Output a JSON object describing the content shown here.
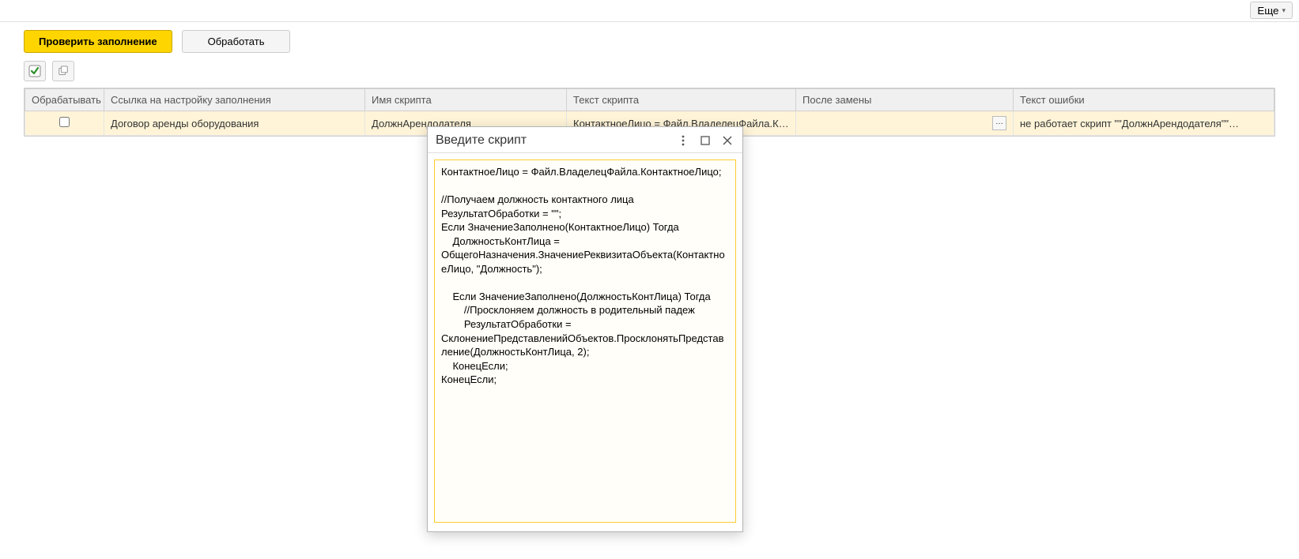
{
  "header": {
    "more": "Еще"
  },
  "toolbar": {
    "check_fill": "Проверить заполнение",
    "process": "Обработать"
  },
  "table": {
    "headers": {
      "process": "Обрабатывать",
      "link": "Ссылка на настройку заполнения",
      "script_name": "Имя скрипта",
      "script_text": "Текст скрипта",
      "after_replace": "После замены",
      "error_text": "Текст ошибки"
    },
    "rows": [
      {
        "process": false,
        "link": "Договор аренды оборудования",
        "script_name": "ДолжнАрендодателя",
        "script_text": "КонтактноеЛицо = Файл.ВладелецФайла.Ко…",
        "after_replace": "",
        "error_text": "не работает скрипт \"\"ДолжнАрендодателя\"\"…"
      }
    ]
  },
  "dialog": {
    "title": "Введите скрипт",
    "script": "КонтактноеЛицо = Файл.ВладелецФайла.КонтактноеЛицо;\n\n//Получаем должность контактного лица\nРезультатОбработки = \"\";\nЕсли ЗначениеЗаполнено(КонтактноеЛицо) Тогда\n    ДолжностьКонтЛица = ОбщегоНазначения.ЗначениеРеквизитаОбъекта(КонтактноеЛицо, \"Должность\");\n\n    Если ЗначениеЗаполнено(ДолжностьКонтЛица) Тогда\n        //Просклоняем должность в родительный падеж\n        РезультатОбработки = СклонениеПредставленийОбъектов.ПросклонятьПредставление(ДолжностьКонтЛица, 2);\n    КонецЕсли;\nКонецЕсли;"
  }
}
